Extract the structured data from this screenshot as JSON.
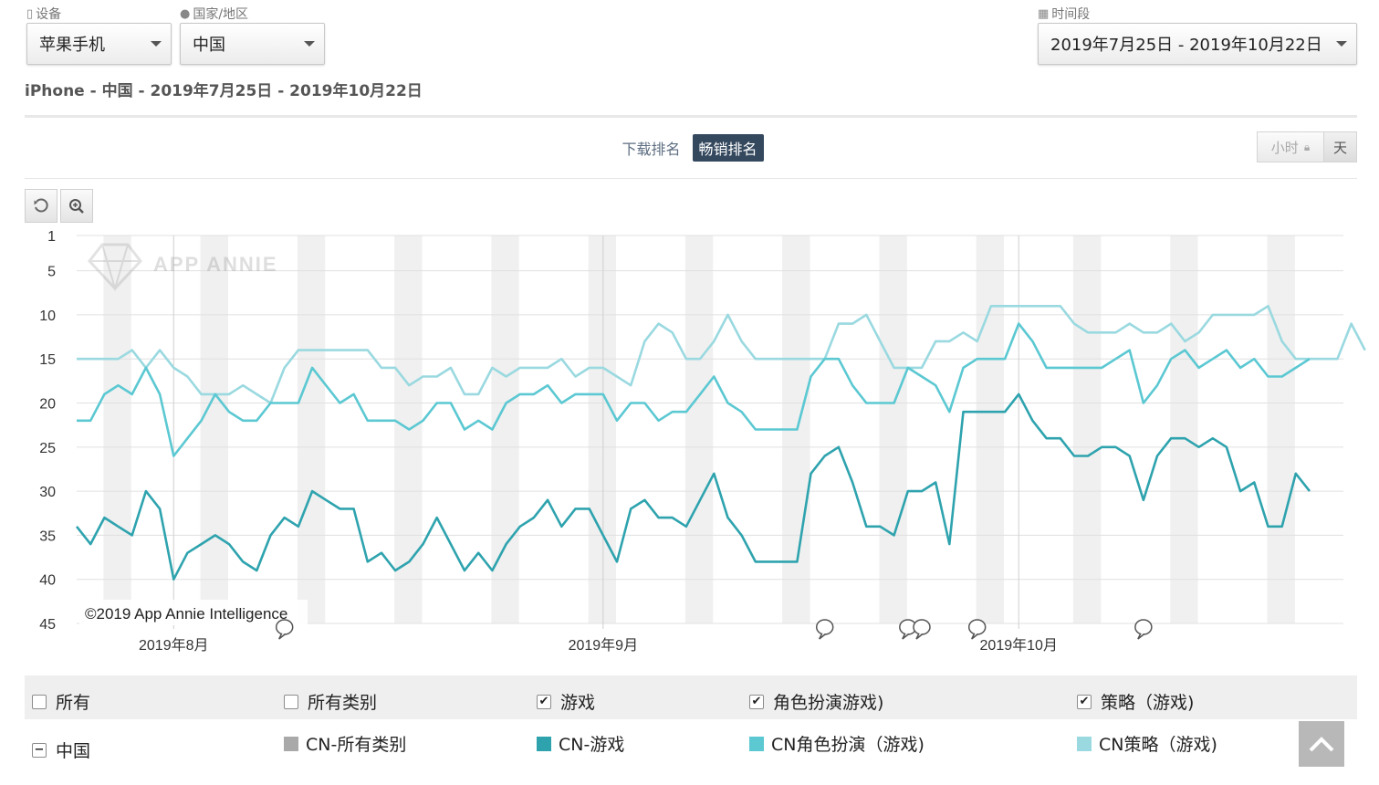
{
  "filters": {
    "device": {
      "label": "设备",
      "value": "苹果手机"
    },
    "region": {
      "label": "国家/地区",
      "value": "中国"
    },
    "period": {
      "label": "时间段",
      "value": "2019年7月25日 - 2019年10月22日"
    }
  },
  "summary": "iPhone - 中国 - 2019年7月25日 - 2019年10月22日",
  "rank_tabs": [
    {
      "label": "下载排名",
      "active": false
    },
    {
      "label": "畅销排名",
      "active": true
    }
  ],
  "granularity": [
    {
      "label": "小时",
      "locked": true
    },
    {
      "label": "天",
      "active": true
    }
  ],
  "toolbar": {
    "reset": "reset-icon",
    "zoom": "zoom-icon"
  },
  "watermark": "APP ANNIE",
  "copyright": "©2019 App Annie Intelligence",
  "chart_data": {
    "type": "line",
    "y_reversed": true,
    "ylim": [
      1,
      45
    ],
    "yticks": [
      1,
      5,
      10,
      15,
      20,
      25,
      30,
      35,
      40,
      45
    ],
    "x_ticks": [
      {
        "label": "2019年8月",
        "day_index": 7
      },
      {
        "label": "2019年9月",
        "day_index": 38
      },
      {
        "label": "2019年10月",
        "day_index": 68
      }
    ],
    "x_range": [
      "2019-07-25",
      "2019-10-22"
    ],
    "event_markers_day_index": [
      15,
      54,
      60,
      61,
      65,
      77
    ],
    "series": [
      {
        "name": "CN策略（游戏）",
        "color": "#9ad9e0",
        "values": [
          15,
          15,
          15,
          15,
          14,
          16,
          14,
          16,
          17,
          19,
          19,
          19,
          18,
          19,
          20,
          16,
          14,
          14,
          14,
          14,
          14,
          14,
          16,
          16,
          18,
          17,
          17,
          16,
          19,
          19,
          16,
          17,
          16,
          16,
          16,
          15,
          17,
          16,
          16,
          17,
          18,
          13,
          11,
          12,
          15,
          15,
          13,
          10,
          13,
          15,
          15,
          15,
          15,
          15,
          15,
          11,
          11,
          10,
          13,
          16,
          16,
          16,
          13,
          13,
          12,
          13,
          9,
          9,
          9,
          9,
          9,
          9,
          11,
          12,
          12,
          12,
          11,
          12,
          12,
          11,
          13,
          12,
          10,
          10,
          10,
          10,
          9,
          13,
          15,
          15,
          15,
          15,
          11,
          14
        ]
      },
      {
        "name": "CN角色扮演（游戏）",
        "color": "#5bc8d2",
        "values": [
          22,
          22,
          19,
          18,
          19,
          16,
          19,
          26,
          24,
          22,
          19,
          21,
          22,
          22,
          20,
          20,
          20,
          16,
          18,
          20,
          19,
          22,
          22,
          22,
          23,
          22,
          20,
          20,
          23,
          22,
          23,
          20,
          19,
          19,
          18,
          20,
          19,
          19,
          19,
          22,
          20,
          20,
          22,
          21,
          21,
          19,
          17,
          20,
          21,
          23,
          23,
          23,
          23,
          17,
          15,
          15,
          18,
          20,
          20,
          20,
          16,
          17,
          18,
          21,
          16,
          15,
          15,
          15,
          11,
          13,
          16,
          16,
          16,
          16,
          16,
          15,
          14,
          20,
          18,
          15,
          14,
          16,
          15,
          14,
          16,
          15,
          17,
          17,
          16,
          15
        ]
      },
      {
        "name": "CN-游戏",
        "color": "#2ea3ae",
        "values": [
          34,
          36,
          33,
          34,
          35,
          30,
          32,
          40,
          37,
          36,
          35,
          36,
          38,
          39,
          35,
          33,
          34,
          30,
          31,
          32,
          32,
          38,
          37,
          39,
          38,
          36,
          33,
          36,
          39,
          37,
          39,
          36,
          34,
          33,
          31,
          34,
          32,
          32,
          35,
          38,
          32,
          31,
          33,
          33,
          34,
          31,
          28,
          33,
          35,
          38,
          38,
          38,
          38,
          28,
          26,
          25,
          29,
          34,
          34,
          35,
          30,
          30,
          29,
          36,
          21,
          21,
          21,
          21,
          19,
          22,
          24,
          24,
          26,
          26,
          25,
          25,
          26,
          31,
          26,
          24,
          24,
          25,
          24,
          25,
          30,
          29,
          34,
          34,
          28,
          30
        ]
      }
    ]
  },
  "legend": {
    "header": [
      {
        "label": "所有",
        "checked": false
      },
      {
        "label": "所有类别",
        "checked": false
      },
      {
        "label": "游戏",
        "checked": true
      },
      {
        "label": "角色扮演游戏)",
        "checked": true
      },
      {
        "label": "策略（游戏)",
        "checked": true
      }
    ],
    "row": {
      "region_label": "中国",
      "items": [
        {
          "label": "CN-所有类别",
          "color": "#a9a9a9"
        },
        {
          "label": "CN-游戏",
          "color": "#2ea3ae"
        },
        {
          "label": "CN角色扮演（游戏)",
          "color": "#5bc8d2"
        },
        {
          "label": "CN策略（游戏)",
          "color": "#9ad9e0"
        }
      ]
    }
  }
}
